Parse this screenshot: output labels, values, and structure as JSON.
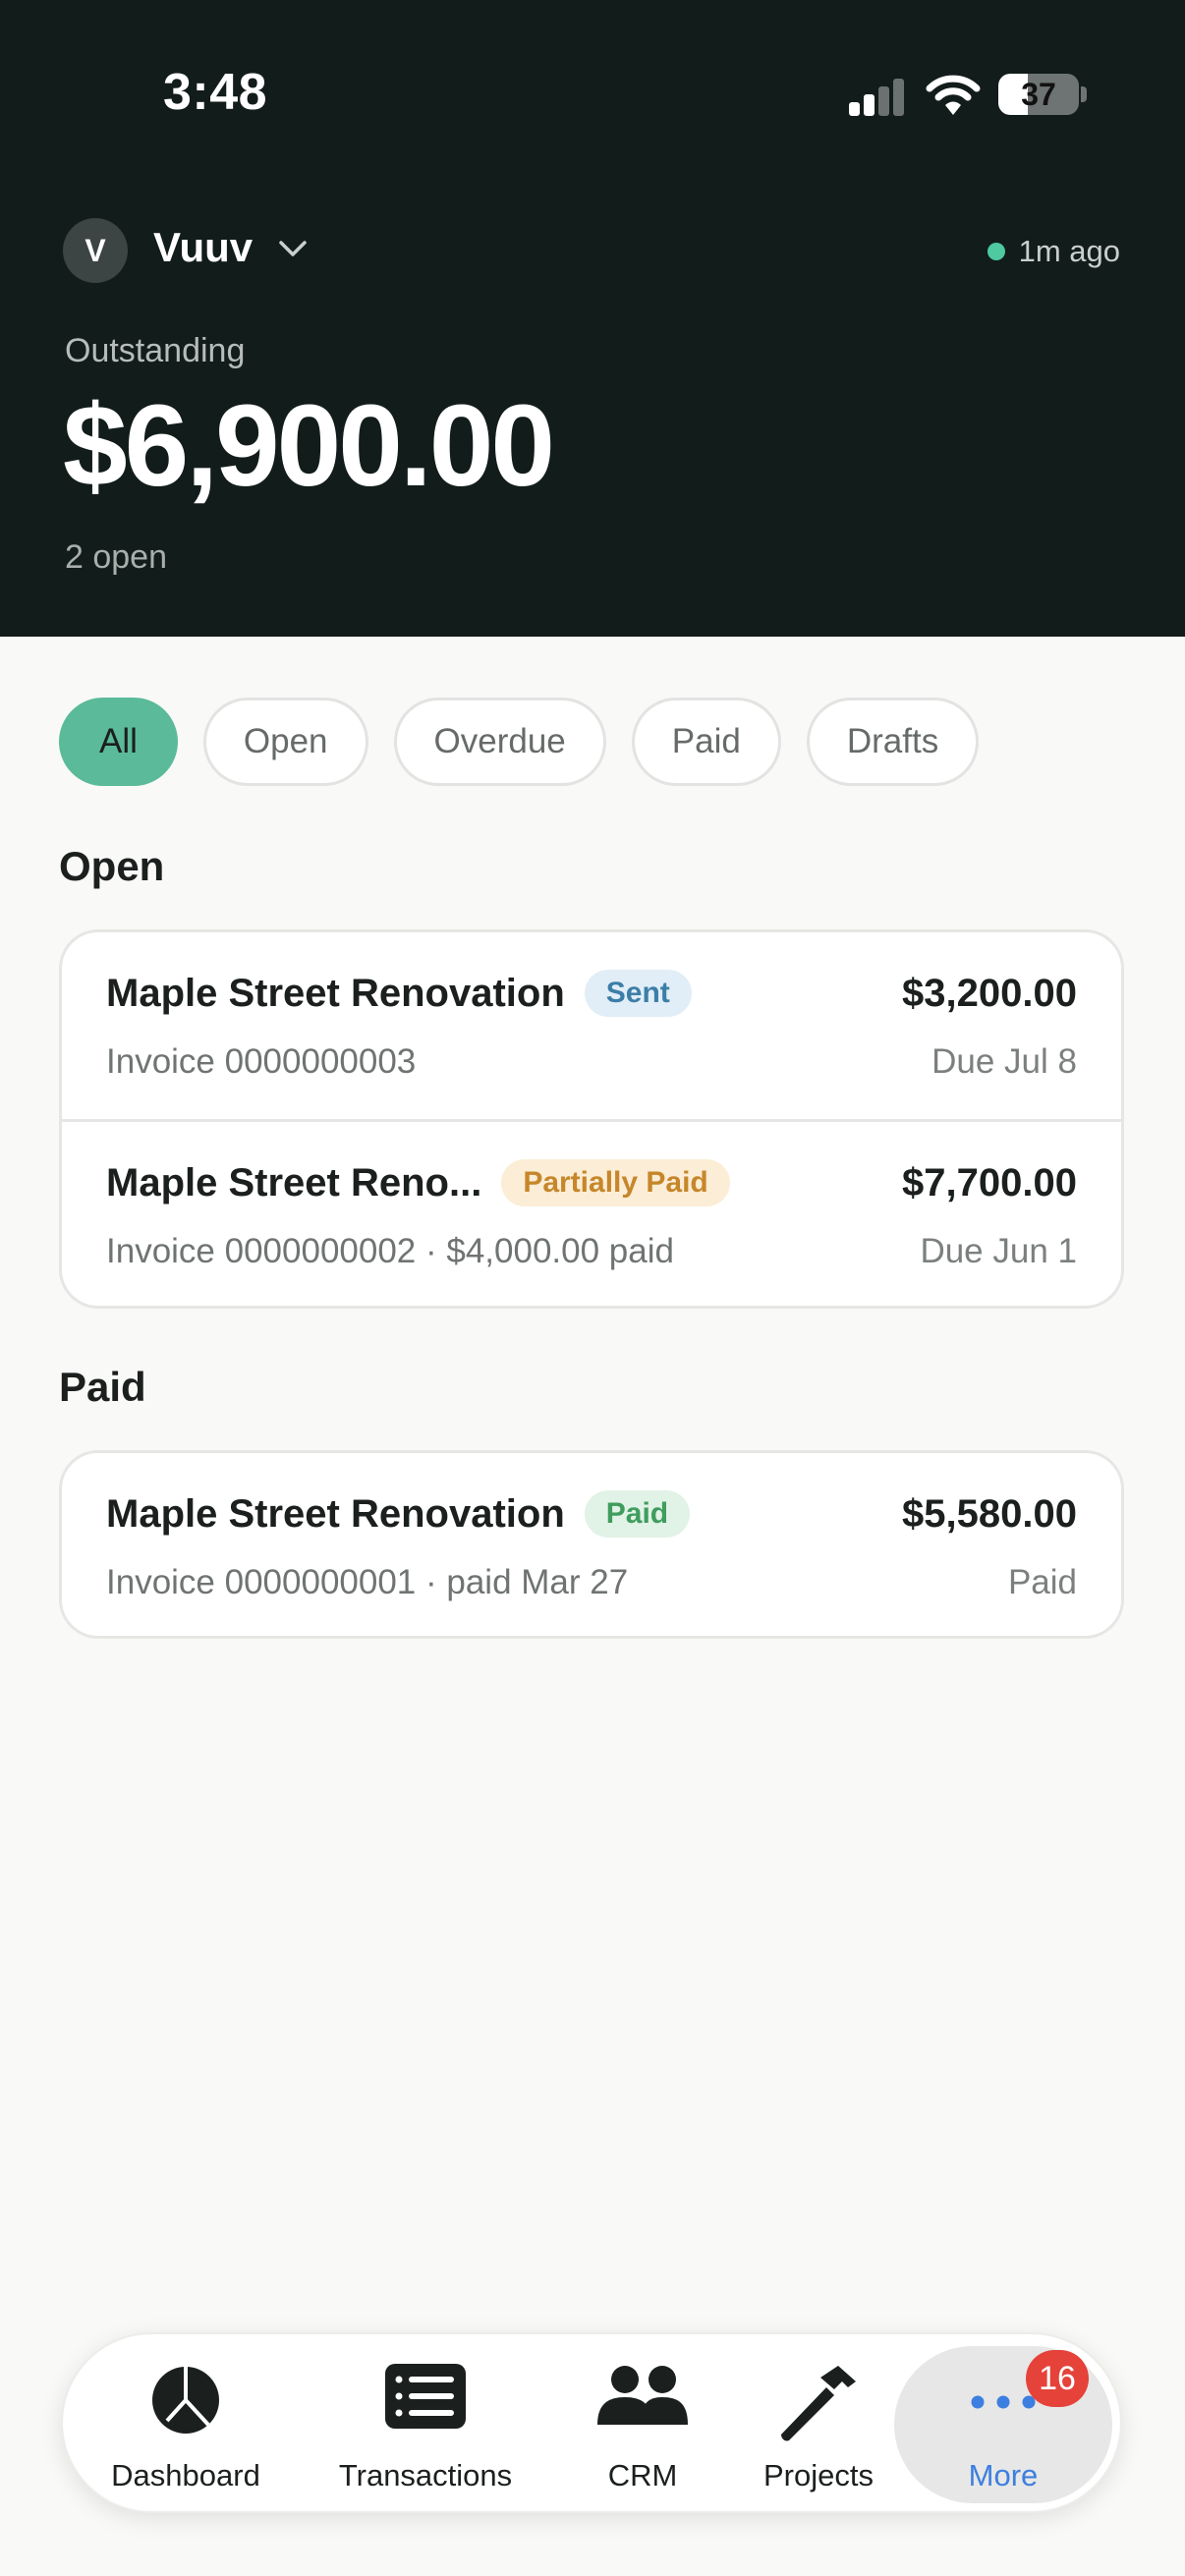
{
  "status_bar": {
    "time": "3:48",
    "battery": "37",
    "battery_level": 0.37
  },
  "header": {
    "org_initial": "V",
    "org_name": "Vuuv",
    "sync_status": "1m ago",
    "outstanding_label": "Outstanding",
    "outstanding_amount": "$6,900.00",
    "open_count": "2 open"
  },
  "filters": [
    {
      "label": "All",
      "active": true
    },
    {
      "label": "Open",
      "active": false
    },
    {
      "label": "Overdue",
      "active": false
    },
    {
      "label": "Paid",
      "active": false
    },
    {
      "label": "Drafts",
      "active": false
    }
  ],
  "sections": {
    "open": {
      "title": "Open",
      "invoices": [
        {
          "title": "Maple Street Renovation",
          "status": "Sent",
          "subtitle": "Invoice 0000000003",
          "amount": "$3,200.00",
          "due": "Due Jul 8"
        },
        {
          "title": "Maple Street Reno...",
          "status": "Partially Paid",
          "subtitle": "Invoice 0000000002 · $4,000.00 paid",
          "amount": "$7,700.00",
          "due": "Due Jun 1"
        }
      ]
    },
    "paid": {
      "title": "Paid",
      "invoices": [
        {
          "title": "Maple Street Renovation",
          "status": "Paid",
          "subtitle": "Invoice 0000000001 · paid Mar 27",
          "amount": "$5,580.00",
          "due": "Paid"
        }
      ]
    }
  },
  "tabbar": {
    "tabs": [
      {
        "label": "Dashboard",
        "icon": "pie-chart-icon"
      },
      {
        "label": "Transactions",
        "icon": "list-icon"
      },
      {
        "label": "CRM",
        "icon": "people-icon"
      },
      {
        "label": "Projects",
        "icon": "hammer-icon"
      },
      {
        "label": "More",
        "icon": "ellipsis-icon",
        "active": true
      }
    ],
    "more_badge": "16"
  },
  "colors": {
    "header_bg": "#121c1b",
    "accent": "#5aba99",
    "active_tab": "#3d7fe0",
    "badge_red": "#e5423a"
  }
}
